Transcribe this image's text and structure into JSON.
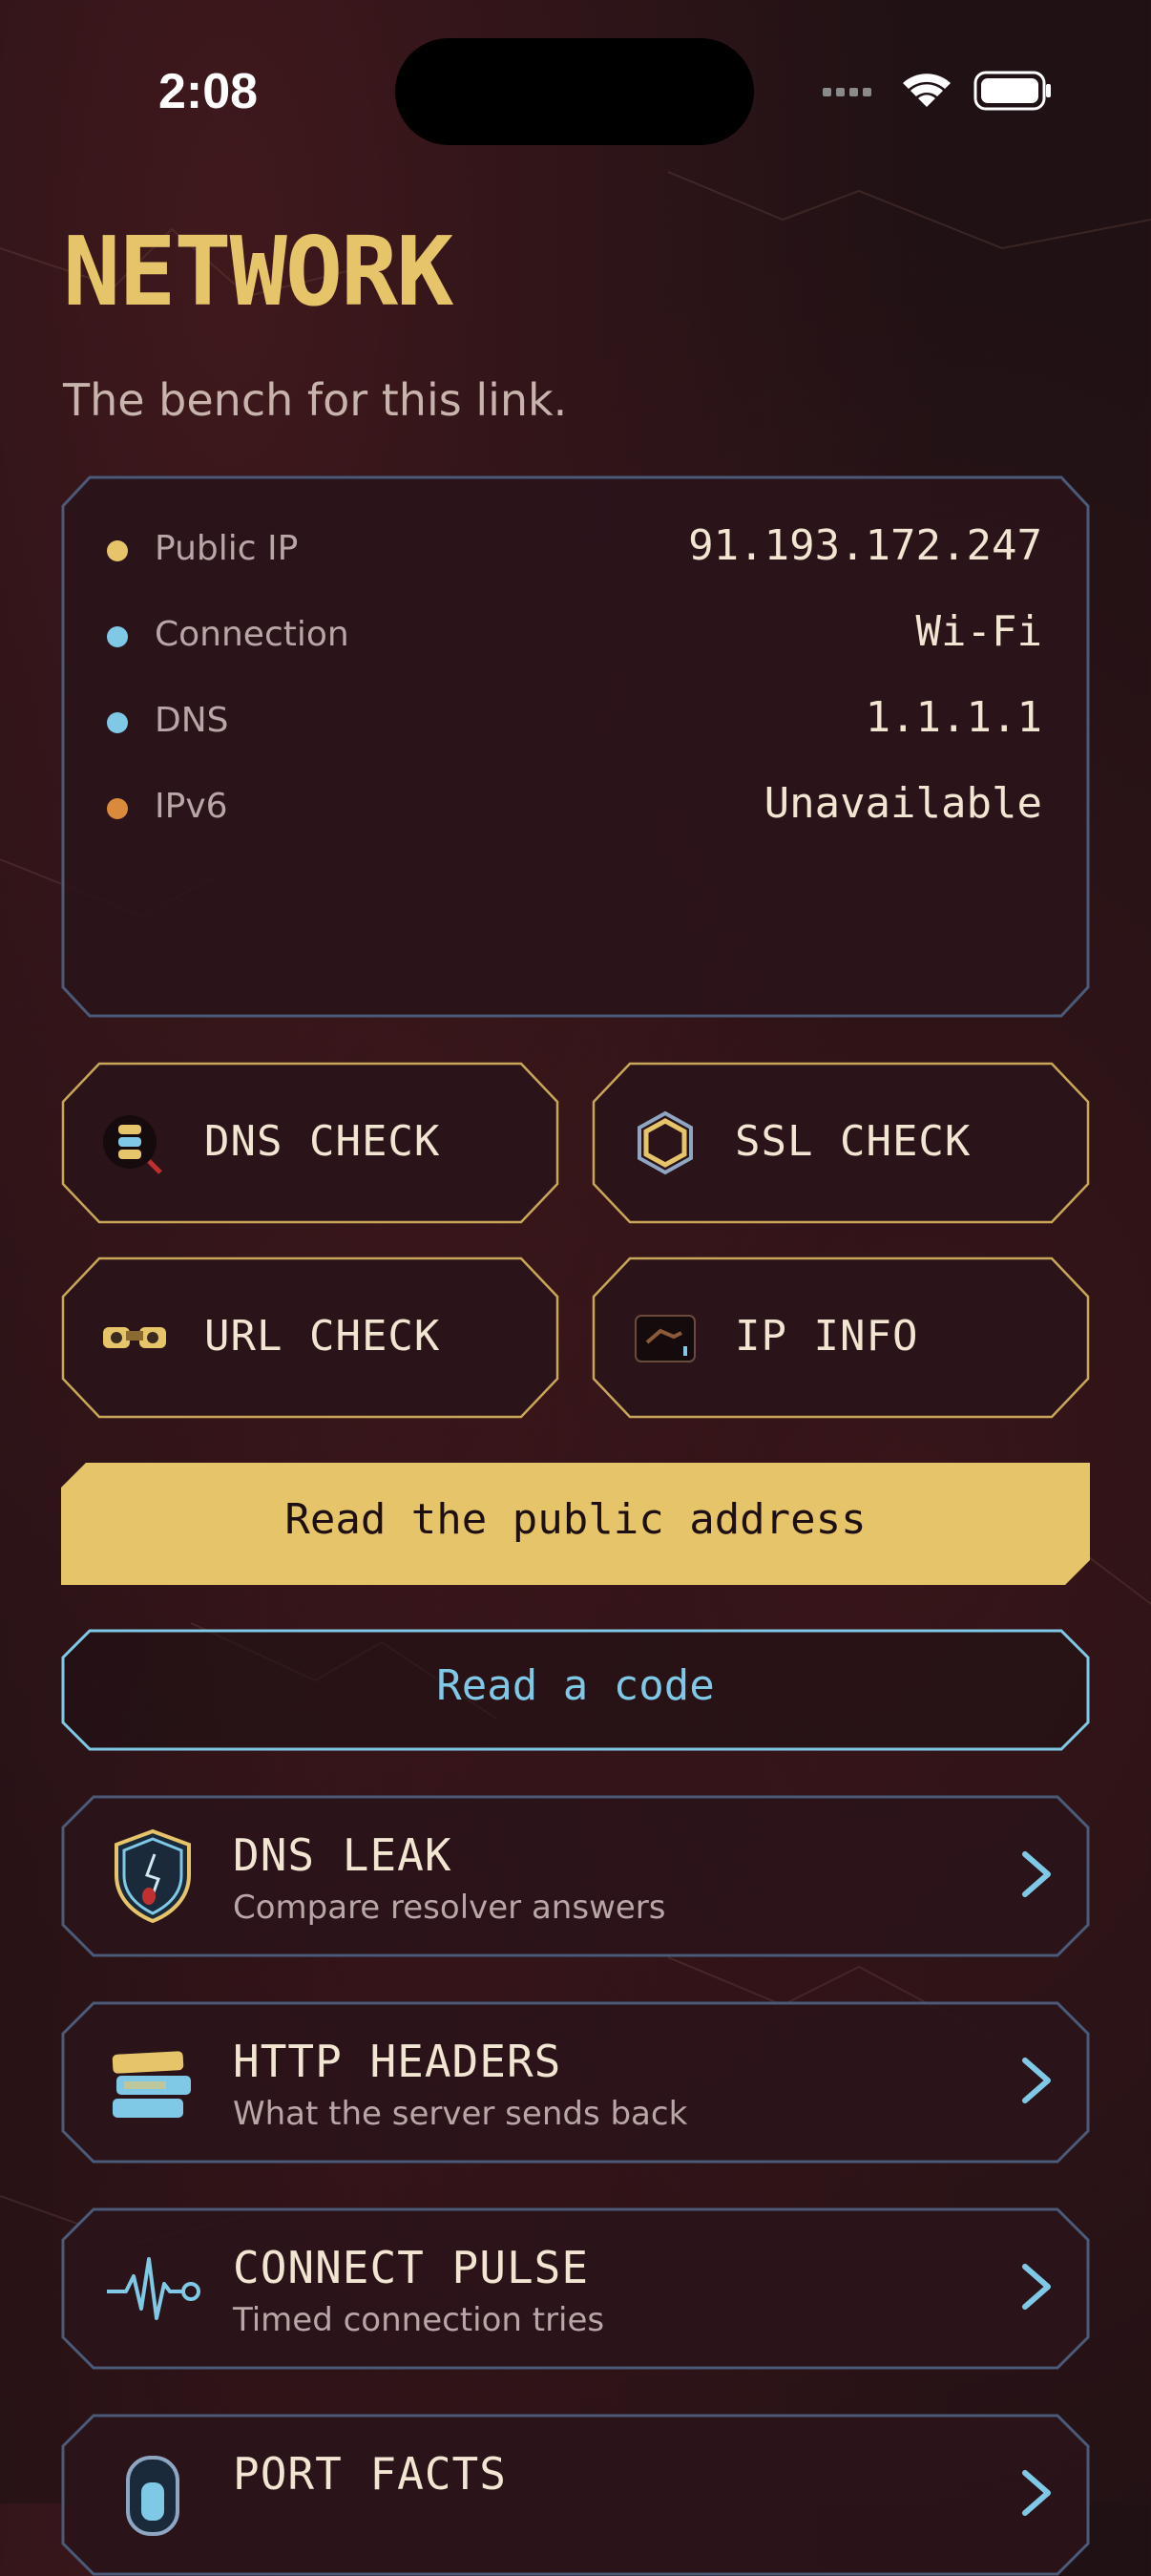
{
  "status_bar": {
    "time": "2:08"
  },
  "header": {
    "title": "NETWORK",
    "subtitle": "The bench for this link."
  },
  "info": [
    {
      "label": "Public IP",
      "value": "91.193.172.247",
      "dot": "#e6c46a"
    },
    {
      "label": "Connection",
      "value": "Wi-Fi",
      "dot": "#7fc8e6"
    },
    {
      "label": "DNS",
      "value": "1.1.1.1",
      "dot": "#7fc8e6"
    },
    {
      "label": "IPv6",
      "value": "Unavailable",
      "dot": "#d98a3a"
    }
  ],
  "tools": [
    {
      "label": "DNS CHECK",
      "icon": "dns-server-icon"
    },
    {
      "label": "SSL CHECK",
      "icon": "hexagon-icon"
    },
    {
      "label": "URL CHECK",
      "icon": "binoculars-icon"
    },
    {
      "label": "IP INFO",
      "icon": "network-card-icon"
    }
  ],
  "actions": {
    "primary": "Read the public address",
    "secondary": "Read a code"
  },
  "rows": [
    {
      "title": "DNS LEAK",
      "subtitle": "Compare resolver answers",
      "icon": "shield-leak-icon"
    },
    {
      "title": "HTTP HEADERS",
      "subtitle": "What the server sends back",
      "icon": "stacked-bars-icon"
    },
    {
      "title": "CONNECT PULSE",
      "subtitle": "Timed connection tries",
      "icon": "pulse-wave-icon"
    },
    {
      "title": "PORT FACTS",
      "subtitle": "",
      "icon": "port-icon"
    }
  ],
  "colors": {
    "gold": "#e6c46a",
    "cyan": "#7fc8e6",
    "panel": "#2a141a",
    "border": "#4a5a78"
  }
}
